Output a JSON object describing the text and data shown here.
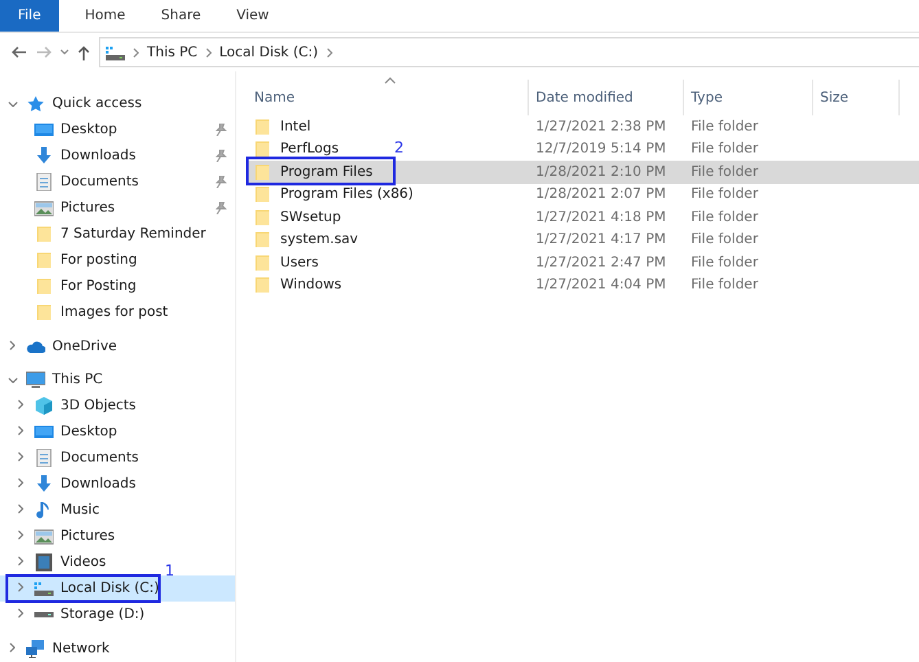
{
  "ribbon": {
    "tabs": [
      {
        "label": "File",
        "selected": true
      },
      {
        "label": "Home",
        "selected": false
      },
      {
        "label": "Share",
        "selected": false
      },
      {
        "label": "View",
        "selected": false
      }
    ]
  },
  "address_bar": {
    "path": [
      "This PC",
      "Local Disk (C:)"
    ]
  },
  "navigation": [
    {
      "label": "Quick access",
      "kind": "star",
      "expanded": true,
      "selected": false,
      "children": [
        {
          "label": "Desktop",
          "kind": "desktop",
          "pinned": true,
          "selected": false
        },
        {
          "label": "Downloads",
          "kind": "download",
          "pinned": true,
          "selected": false
        },
        {
          "label": "Documents",
          "kind": "document",
          "pinned": true,
          "selected": false
        },
        {
          "label": "Pictures",
          "kind": "pictures",
          "pinned": true,
          "selected": false
        },
        {
          "label": "7 Saturday Reminder",
          "kind": "folder",
          "pinned": false,
          "selected": false
        },
        {
          "label": "For posting",
          "kind": "folder",
          "pinned": false,
          "selected": false
        },
        {
          "label": "For Posting",
          "kind": "folder",
          "pinned": false,
          "selected": false
        },
        {
          "label": "Images for post",
          "kind": "folder",
          "pinned": false,
          "selected": false
        }
      ]
    },
    {
      "label": "OneDrive",
      "kind": "cloud",
      "expanded": false,
      "selected": false
    },
    {
      "label": "This PC",
      "kind": "computer",
      "expanded": true,
      "selected": false,
      "children": [
        {
          "label": "3D Objects",
          "kind": "cube",
          "expanded": false,
          "selected": false
        },
        {
          "label": "Desktop",
          "kind": "desktop",
          "expanded": false,
          "selected": false
        },
        {
          "label": "Documents",
          "kind": "document",
          "expanded": false,
          "selected": false
        },
        {
          "label": "Downloads",
          "kind": "download",
          "expanded": false,
          "selected": false
        },
        {
          "label": "Music",
          "kind": "music",
          "expanded": false,
          "selected": false
        },
        {
          "label": "Pictures",
          "kind": "pictures",
          "expanded": false,
          "selected": false
        },
        {
          "label": "Videos",
          "kind": "video",
          "expanded": false,
          "selected": false
        },
        {
          "label": "Local Disk (C:)",
          "kind": "system-drive",
          "expanded": false,
          "selected": true,
          "annotation": "1"
        },
        {
          "label": "Storage (D:)",
          "kind": "drive",
          "expanded": false,
          "selected": false
        }
      ]
    },
    {
      "label": "Network",
      "kind": "network",
      "expanded": false,
      "selected": false
    }
  ],
  "file_list": {
    "columns": [
      "Name",
      "Date modified",
      "Type",
      "Size"
    ],
    "rows": [
      {
        "name": "Intel",
        "date": "1/27/2021 2:38 PM",
        "type": "File folder",
        "selected": false
      },
      {
        "name": "PerfLogs",
        "date": "12/7/2019 5:14 PM",
        "type": "File folder",
        "selected": false
      },
      {
        "name": "Program Files",
        "date": "1/28/2021 2:10 PM",
        "type": "File folder",
        "selected": true,
        "annotation": "2"
      },
      {
        "name": "Program Files (x86)",
        "date": "1/28/2021 2:07 PM",
        "type": "File folder",
        "selected": false
      },
      {
        "name": "SWsetup",
        "date": "1/27/2021 4:18 PM",
        "type": "File folder",
        "selected": false
      },
      {
        "name": "system.sav",
        "date": "1/27/2021 4:17 PM",
        "type": "File folder",
        "selected": false
      },
      {
        "name": "Users",
        "date": "1/27/2021 2:47 PM",
        "type": "File folder",
        "selected": false
      },
      {
        "name": "Windows",
        "date": "1/27/2021 4:04 PM",
        "type": "File folder",
        "selected": false
      }
    ]
  }
}
